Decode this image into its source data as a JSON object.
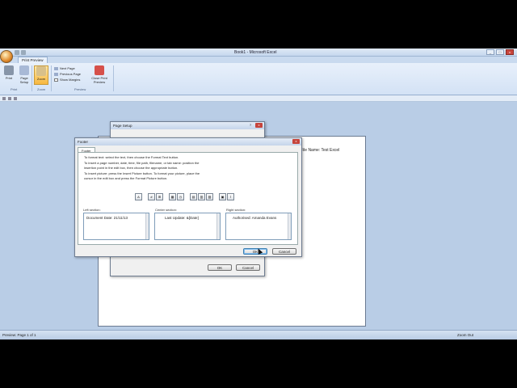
{
  "window": {
    "title": "Book1 - Microsoft Excel",
    "controls": {
      "minimize": "_",
      "maximize": "□",
      "close": "x"
    }
  },
  "ribbon": {
    "active_tab": "Print Preview",
    "buttons": {
      "print": "Print",
      "page_setup": "Page Setup",
      "zoom": "Zoom",
      "next_page": "Next Page",
      "previous_page": "Previous Page",
      "show_margins": "Show Margins",
      "close_preview": "Close Print Preview"
    },
    "groups": {
      "print": "Print",
      "zoom": "Zoom",
      "preview": "Preview"
    }
  },
  "preview": {
    "page_text": "File Name: Test Excel"
  },
  "status_bar": {
    "left": "Preview: Page 1 of 1",
    "zoom_out": "Zoom Out"
  },
  "page_setup_dialog": {
    "title": "Page Setup",
    "help": "?",
    "close": "x",
    "ok": "OK",
    "cancel": "Cancel"
  },
  "footer_dialog": {
    "title": "Footer",
    "tab": "Footer",
    "close": "x",
    "instructions": [
      "To format text:  select the text, then choose the Format Text button.",
      "To insert a page number, date, time, file path, filename, or tab name:  position the",
      "      insertion point in the edit box, then choose the appropriate button.",
      "To insert picture: press the Insert Picture button.  To format your picture, place the",
      "      cursor in the edit box and press the Format Picture button."
    ],
    "toolbar_icons": [
      "format-text-icon",
      "page-number-icon",
      "number-of-pages-icon",
      "date-icon",
      "time-icon",
      "file-path-icon",
      "file-name-icon",
      "sheet-name-icon",
      "insert-picture-icon",
      "format-picture-icon"
    ],
    "toolbar_glyphs": [
      "A",
      "#",
      "⊞",
      "▦",
      "◷",
      "▤",
      "▥",
      "▧",
      "▣",
      "⌇"
    ],
    "left_section_label": "Left section:",
    "center_section_label": "Center section:",
    "right_section_label": "Right section:",
    "left_section_text": "Document Date: 21/11/13",
    "center_section_text": "Last Update: &[Date]",
    "right_section_text": "Authorised: Amanda Evans",
    "ok": "OK",
    "cancel": "Cancel"
  }
}
